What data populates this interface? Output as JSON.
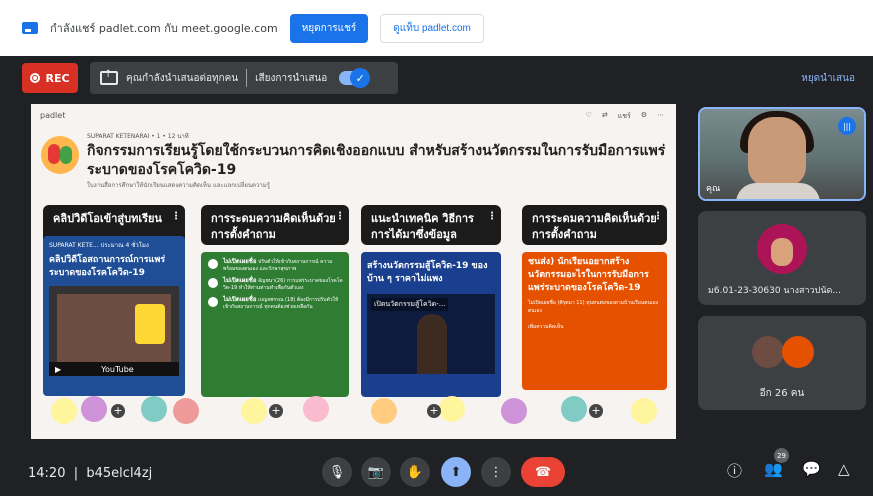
{
  "share_bar": {
    "message": "กำลังแชร์ padlet.com กับ meet.google.com",
    "stop_sharing": "หยุดการแชร์",
    "switch_to": "ดูแท็บ padlet.com"
  },
  "present_bar": {
    "rec": "REC",
    "presenting_to_everyone": "คุณกำลังนำเสนอต่อทุกคน",
    "present_audio": "เสียงการนำเสนอ",
    "stop_presenting": "หยุดนำเสนอ"
  },
  "padlet": {
    "brand": "padlet",
    "author": "SUPARAT KETENARAI • 1 • 12 นาที",
    "title": "กิจกรรมการเรียนรู้โดยใช้กระบวนการคิดเชิงออกแบบ สำหรับสร้างนวัตกรรมในการรับมือการแพร่ระบาดของโรคโควิด-19",
    "subtitle": "ใบงานสื่อการศึกษาให้นักเรียนแสดงความคิดเห็น และแลกเปลี่ยนความรู้",
    "tools": [
      "♡",
      "⇄",
      "แชร์",
      "⚙",
      "⋯"
    ],
    "columns": [
      {
        "title": "คลิปวิดีโอเข้าสู่บทเรียน"
      },
      {
        "title": "การระดมความคิดเห็นด้วยการตั้งคำถาม"
      },
      {
        "title": "แนะนำเทคนิค วิธีการ การได้มาซึ่งข้อมูล"
      },
      {
        "title": "การระดมความคิดเห็นด้วยการตั้งคำถาม"
      }
    ],
    "card1": {
      "meta": "SUPARAT KETE... ประมาณ 4 ชั่วโมง",
      "title": "คลิปวิดีโอสถานการณ์การแพร่ระบาดของโรคโควิด-19",
      "video_title": "สถานการณ์โควิด-19",
      "video_brand": "YouTube"
    },
    "card2": {
      "lines": [
        {
          "name": "ไม่เปิดเผยชื่อ",
          "text": "ปรับตัวให้เข้ากับสถานการณ์ ความพร้อมของตนเอง และรักษาสุขภาพ"
        },
        {
          "name": "ไม่เปิดเผยชื่อ",
          "text": "อัญชนา(26) การแพร่ระบาดของโรคโควิด-19 ทำให้ท่านท่านทำเพื่อกันตัวเอง"
        },
        {
          "name": "ไม่เปิดเผยชื่อ",
          "text": "เบญจพรรณ (18) ต้องมีการปรับตัวให้เข้ากับสถานการณ์ ทุกคนต้องช่วยเหลือกัน"
        }
      ]
    },
    "card3": {
      "title": "สร้างนวัตกรรมสู้โควิด-19 ของบ้าน ๆ ราคาไม่แพง",
      "video_label": "เปิดนวัตกรรมสู้โควิด-..."
    },
    "card4": {
      "title": "ชนส่ง) นักเรียนอยากสร้างนวัตกรรมอะไรในการรับมือการแพร่ระบาดของโรคโควิด-19",
      "comment": "ไม่เปิดเผยชื่อ (ศิรุตมา 11) ทุนทนต่อของตามบ้านเรือนตนเองตนเอง",
      "foot": "เพิ่มความคิดเห็น"
    }
  },
  "participants": {
    "self_name": "คุณ",
    "tile2_name": "ม6.01-23-30630 นางสาวปนัด...",
    "others_label": "อีก 26 คน"
  },
  "bottom_bar": {
    "time": "14:20",
    "separator": "|",
    "meeting_code": "b45elcl4zj",
    "people_count": "29"
  },
  "colors": {
    "accent": "#1a73e8",
    "end_call": "#ea4335",
    "rec": "#d93025"
  }
}
